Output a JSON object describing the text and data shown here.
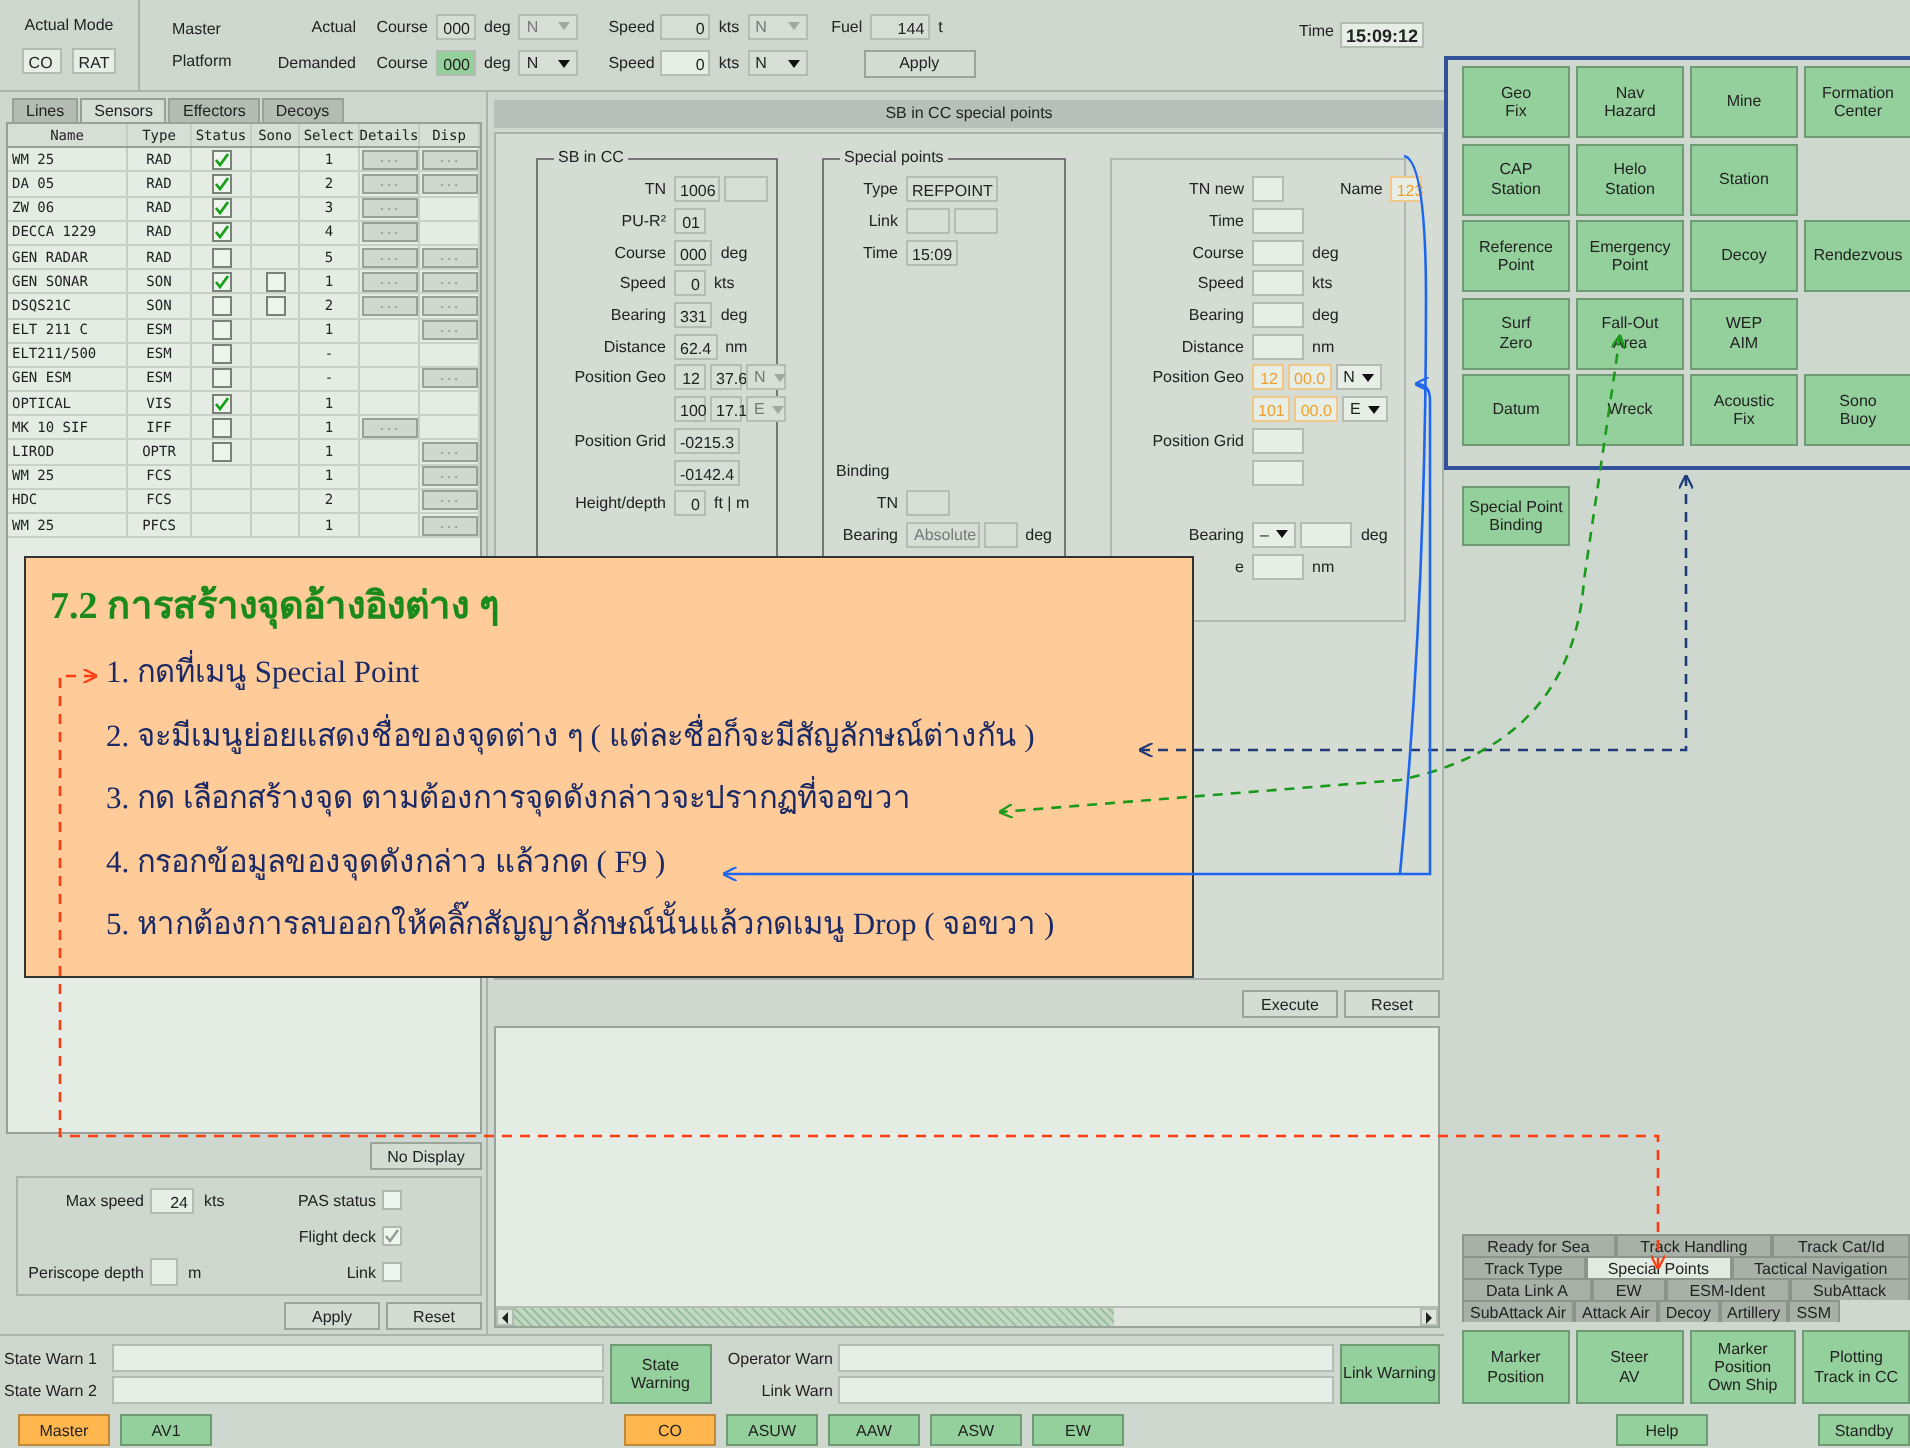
{
  "top_bar": {
    "mode": {
      "label": "Actual Mode",
      "values": [
        "CO",
        "RAT"
      ]
    },
    "roles": [
      "Master",
      "Platform"
    ],
    "rows": [
      {
        "label": "Actual",
        "course_label": "Course",
        "course": "000",
        "course_unit": "deg",
        "course_dir": "N",
        "speed_label": "Speed",
        "speed": "0",
        "speed_unit": "kts",
        "speed_dir": "N",
        "editable": false,
        "course_focused": false
      },
      {
        "label": "Demanded",
        "course_label": "Course",
        "course": "000",
        "course_unit": "deg",
        "course_dir": "N",
        "speed_label": "Speed",
        "speed": "0",
        "speed_unit": "kts",
        "speed_dir": "N",
        "editable": true,
        "course_focused": true
      }
    ],
    "fuel": {
      "label": "Fuel",
      "value": "144",
      "unit": "t"
    },
    "apply": "Apply",
    "time": {
      "label": "Time",
      "value": "15:09:12"
    }
  },
  "left_panel": {
    "tabs": [
      {
        "label": "Lines",
        "selected": false
      },
      {
        "label": "Sensors",
        "selected": true
      },
      {
        "label": "Effectors",
        "selected": false
      },
      {
        "label": "Decoys",
        "selected": false
      }
    ],
    "columns": [
      "Name",
      "Type",
      "Status",
      "Sono",
      "Select",
      "Details",
      "Disp"
    ],
    "rows": [
      {
        "name": "WM 25",
        "type": "RAD",
        "status": true,
        "select": "1",
        "details": "...",
        "disp": "..."
      },
      {
        "name": "DA 05",
        "type": "RAD",
        "status": true,
        "select": "2",
        "details": "...",
        "disp": "..."
      },
      {
        "name": "ZW 06",
        "type": "RAD",
        "status": true,
        "select": "3",
        "details": "..."
      },
      {
        "name": "DECCA 1229",
        "type": "RAD",
        "status": true,
        "select": "4",
        "details": "..."
      },
      {
        "name": "GEN RADAR",
        "type": "RAD",
        "status": false,
        "select": "5",
        "details": "...",
        "disp": "..."
      },
      {
        "name": "GEN SONAR",
        "type": "SON",
        "status": true,
        "sono": false,
        "select": "1",
        "details": "...",
        "disp": "..."
      },
      {
        "name": "DSQS21C",
        "type": "SON",
        "status": false,
        "sono": false,
        "select": "2",
        "details": "...",
        "disp": "..."
      },
      {
        "name": "ELT 211 C",
        "type": "ESM",
        "status": false,
        "select": "1",
        "disp": "..."
      },
      {
        "name": "ELT211/500",
        "type": "ESM",
        "status": false,
        "select": "-"
      },
      {
        "name": "GEN ESM",
        "type": "ESM",
        "status": false,
        "select": "-",
        "disp": "..."
      },
      {
        "name": "OPTICAL",
        "type": "VIS",
        "status": true,
        "select": "1"
      },
      {
        "name": "MK 10 SIF",
        "type": "IFF",
        "status": false,
        "select": "1",
        "details": "..."
      },
      {
        "name": "LIROD",
        "type": "OPTR",
        "status": false,
        "select": "1",
        "disp": "..."
      },
      {
        "name": "WM 25",
        "type": "FCS",
        "select": "1",
        "disp": "..."
      },
      {
        "name": "HDC",
        "type": "FCS",
        "select": "2",
        "disp": "..."
      },
      {
        "name": "WM 25",
        "type": "PFCS",
        "select": "1",
        "disp": "..."
      }
    ],
    "no_display": "No Display",
    "settings": {
      "max_speed": {
        "label": "Max speed",
        "value": "24",
        "unit": "kts"
      },
      "periscope": {
        "label": "Periscope depth",
        "unit": "m"
      },
      "checks": [
        {
          "label": "PAS status",
          "checked": false
        },
        {
          "label": "Flight deck",
          "checked": true
        },
        {
          "label": "Link",
          "checked": false
        }
      ]
    },
    "buttons": [
      "Apply",
      "Reset"
    ]
  },
  "sb_panel": {
    "title": "SB in CC special points",
    "groups": [
      {
        "title": "SB in CC",
        "rows": [
          {
            "label": "TN",
            "items": [
              {
                "kind": "field",
                "value": "1006"
              },
              {
                "kind": "field"
              }
            ]
          },
          {
            "label": "PU-R²",
            "items": [
              {
                "kind": "field",
                "value": "01"
              }
            ]
          },
          {
            "label": "Course",
            "items": [
              {
                "kind": "field",
                "value": "000"
              },
              {
                "kind": "unit",
                "text": "deg"
              }
            ]
          },
          {
            "label": "Speed",
            "items": [
              {
                "kind": "field",
                "value": "0"
              },
              {
                "kind": "unit",
                "text": "kts"
              }
            ]
          },
          {
            "label": "Bearing",
            "items": [
              {
                "kind": "field",
                "value": "331"
              },
              {
                "kind": "unit",
                "text": "deg"
              }
            ]
          },
          {
            "label": "Distance",
            "items": [
              {
                "kind": "field",
                "value": "62.4"
              },
              {
                "kind": "unit",
                "text": "nm"
              }
            ]
          },
          {
            "label": "Position Geo",
            "items": [
              {
                "kind": "field",
                "value": "12"
              },
              {
                "kind": "field",
                "value": "37.6"
              },
              {
                "kind": "select",
                "value": "N",
                "disabled": true
              }
            ]
          },
          {
            "items": [
              {
                "kind": "field",
                "value": "100"
              },
              {
                "kind": "field",
                "value": "17.1"
              },
              {
                "kind": "select",
                "value": "E",
                "disabled": true
              }
            ]
          },
          {
            "label": "Position Grid",
            "items": [
              {
                "kind": "field",
                "value": "-0215.3"
              }
            ]
          },
          {
            "items": [
              {
                "kind": "field",
                "value": "-0142.4"
              }
            ]
          },
          {
            "label": "Height/depth",
            "items": [
              {
                "kind": "field",
                "value": "0"
              },
              {
                "kind": "unit",
                "text": "ft | m"
              }
            ]
          }
        ]
      },
      {
        "title": "Special points",
        "rows": [
          {
            "label": "Type",
            "items": [
              {
                "kind": "field",
                "value": "REFPOINT"
              }
            ]
          },
          {
            "label": "Link",
            "items": [
              {
                "kind": "field"
              },
              {
                "kind": "field"
              }
            ]
          },
          {
            "label": "Time",
            "items": [
              {
                "kind": "field",
                "value": "15:09"
              }
            ]
          }
        ],
        "lower_title": "Binding",
        "lower_rows": [
          {
            "label": "TN",
            "items": [
              {
                "kind": "field"
              }
            ]
          },
          {
            "label": "Bearing",
            "items": [
              {
                "kind": "select",
                "value": "Absolute",
                "disabled": true
              },
              {
                "kind": "field"
              },
              {
                "kind": "unit",
                "text": "deg"
              }
            ]
          }
        ]
      },
      {
        "rows": [
          {
            "label": "TN new",
            "items": [
              {
                "kind": "field",
                "modified": false
              },
              {
                "kind": "label",
                "text": "Name"
              },
              {
                "kind": "field",
                "value": "123",
                "modified": true
              }
            ]
          },
          {
            "label": "Time",
            "items": [
              {
                "kind": "field",
                "modified": false
              }
            ]
          },
          {
            "label": "Course",
            "items": [
              {
                "kind": "field",
                "modified": false
              },
              {
                "kind": "unit",
                "text": "deg"
              }
            ]
          },
          {
            "label": "Speed",
            "items": [
              {
                "kind": "field",
                "modified": false
              },
              {
                "kind": "unit",
                "text": "kts"
              }
            ]
          },
          {
            "label": "Bearing",
            "items": [
              {
                "kind": "field",
                "modified": false
              },
              {
                "kind": "unit",
                "text": "deg"
              }
            ]
          },
          {
            "label": "Distance",
            "items": [
              {
                "kind": "field",
                "modified": false
              },
              {
                "kind": "unit",
                "text": "nm"
              }
            ]
          },
          {
            "label": "Position Geo",
            "items": [
              {
                "kind": "field",
                "value": "12",
                "modified": true
              },
              {
                "kind": "field",
                "value": "00.0",
                "modified": true
              },
              {
                "kind": "select",
                "value": "N",
                "disabled": false
              }
            ]
          },
          {
            "items": [
              {
                "kind": "field",
                "value": "101",
                "modified": true
              },
              {
                "kind": "field",
                "value": "00.0",
                "modified": true
              },
              {
                "kind": "select",
                "value": "E",
                "disabled": false
              }
            ]
          },
          {
            "label": "Position Grid",
            "items": [
              {
                "kind": "field",
                "modified": false
              }
            ]
          },
          {
            "items": [
              {
                "kind": "field",
                "modified": false
              }
            ]
          }
        ],
        "lower_rows": [
          {
            "label": "Bearing",
            "items": [
              {
                "kind": "select",
                "value": "–",
                "disabled": false
              },
              {
                "kind": "field",
                "modified": false
              },
              {
                "kind": "unit",
                "text": "deg"
              }
            ]
          },
          {
            "label": "e",
            "items": [
              {
                "kind": "field",
                "modified": false
              },
              {
                "kind": "unit",
                "text": "nm"
              }
            ]
          }
        ]
      }
    ],
    "buttons": [
      "Execute",
      "Reset"
    ]
  },
  "status": {
    "warn_labels": [
      "State Warn 1",
      "State Warn 2"
    ],
    "state_button": "State Warning",
    "op_labels": [
      "Operator Warn",
      "Link Warn"
    ],
    "link_button": "Link Warning"
  },
  "right_panel": {
    "points": [
      [
        "Geo\nFix",
        "Nav\nHazard",
        "Mine",
        "Formation\nCenter"
      ],
      [
        "CAP\nStation",
        "Helo\nStation",
        "Station"
      ],
      [
        "Reference\nPoint",
        "Emergency\nPoint",
        "Decoy",
        "Rendezvous"
      ],
      [
        "Surf\nZero",
        "Fall-Out\nArea",
        "WEP\nAIM"
      ],
      [
        "Datum",
        "Wreck",
        "Acoustic\nFix",
        "Sono\nBuoy"
      ]
    ],
    "binding": "Special Point\nBinding",
    "tab_rows": [
      [
        {
          "label": "Ready for Sea",
          "selected": false
        },
        {
          "label": "Track Handling",
          "selected": false
        },
        {
          "label": "Track Cat/Id",
          "selected": false
        }
      ],
      [
        {
          "label": "Track Type",
          "selected": false
        },
        {
          "label": "Special Points",
          "selected": true
        },
        {
          "label": "Tactical Navigation",
          "selected": false
        }
      ],
      [
        {
          "label": "Data Link A",
          "selected": false
        },
        {
          "label": "EW",
          "selected": false
        },
        {
          "label": "ESM-Ident",
          "selected": false
        },
        {
          "label": "SubAttack",
          "selected": false
        }
      ],
      [
        {
          "label": "SubAttack Air",
          "selected": false
        },
        {
          "label": "Attack Air",
          "selected": false
        },
        {
          "label": "Decoy",
          "selected": false
        },
        {
          "label": "Artillery",
          "selected": false
        },
        {
          "label": "SSM",
          "selected": false
        }
      ]
    ],
    "actions": [
      "Marker\nPosition",
      "Steer\nAV",
      "Marker\nPosition\nOwn Ship",
      "Plotting\nTrack in CC"
    ]
  },
  "bottom_bar": {
    "groups": [
      [
        {
          "label": "Master",
          "selected": true
        },
        {
          "label": "AV1",
          "selected": false
        }
      ],
      [
        {
          "label": "CO",
          "selected": true
        },
        {
          "label": "ASUW",
          "selected": false
        },
        {
          "label": "AAW",
          "selected": false
        },
        {
          "label": "ASW",
          "selected": false
        },
        {
          "label": "EW",
          "selected": false
        }
      ],
      [
        {
          "label": "Help",
          "selected": false
        }
      ],
      [
        {
          "label": "Standby",
          "selected": false
        }
      ]
    ]
  },
  "callout": {
    "title": "7.2 การสร้างจุดอ้างอิงต่าง ๆ",
    "steps": [
      "1. กดที่เมนู Special Point",
      "2. จะมีเมนูย่อยแสดงชื่อของจุดต่าง ๆ ( แต่ละชื่อก็จะมีสัญลักษณ์ต่างกัน )",
      "3. กด เลือกสร้างจุด ตามต้องการจุดดังกล่าวจะปรากฏที่จอขวา",
      "4. กรอกข้อมูลของจุดดังกล่าว แล้วกด ( F9 )",
      "5. หากต้องการลบออกให้คลิ๊กสัญญาลักษณ์นั้นแล้วกดเมนู Drop ( จอขวา )"
    ]
  }
}
